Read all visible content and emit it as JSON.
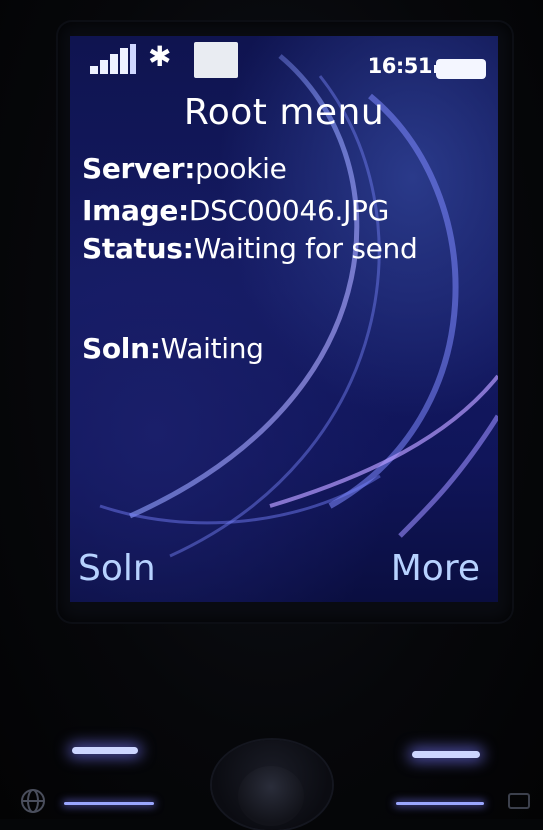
{
  "status_bar": {
    "time": "16:51",
    "bluetooth_glyph": "✱",
    "icons": [
      "signal-icon",
      "bluetooth-icon",
      "memory-card-icon",
      "battery-icon"
    ]
  },
  "screen": {
    "title": "Root menu",
    "fields": {
      "server_label": "Server:",
      "server_value": "pookie",
      "image_label": "Image:",
      "image_value": "DSC00046.JPG",
      "status_label": "Status:",
      "status_value": "Waiting for send",
      "soln_label": "Soln:",
      "soln_value": "Waiting"
    }
  },
  "softkeys": {
    "left": "Soln",
    "right": "More"
  },
  "colors": {
    "screen_bg": "#141a62",
    "text": "#ffffff",
    "softkey_text": "#b7d2ff",
    "key_light": "#cdd6ff"
  }
}
